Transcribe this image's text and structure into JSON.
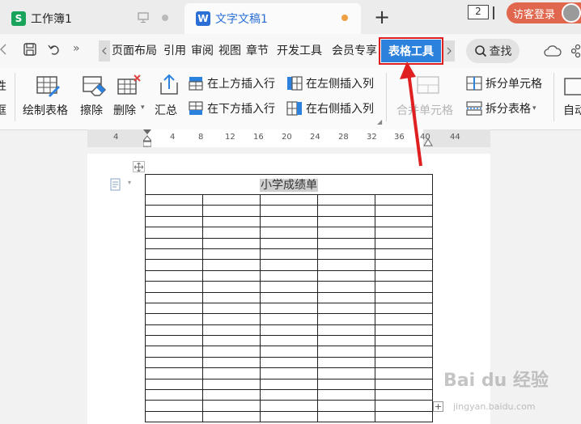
{
  "tabs": [
    {
      "label": "工作簿1",
      "icon": "S",
      "color": "#1aa35a"
    },
    {
      "label": "文字文稿1",
      "icon": "W",
      "color": "#2b6fd6"
    }
  ],
  "new_tab_symbol": "+",
  "window_count": "2",
  "login_label": "访客登录",
  "menu": {
    "items": [
      "页面布局",
      "引用",
      "审阅",
      "视图",
      "章节",
      "开发工具",
      "会员专享"
    ],
    "active": "表格工具",
    "search": "查找"
  },
  "ribbon": {
    "left_partial": [
      "性",
      "框"
    ],
    "draw_table": "绘制表格",
    "erase": "擦除",
    "delete": "删除",
    "summary": "汇总",
    "insert_above": "在上方插入行",
    "insert_below": "在下方插入行",
    "insert_left": "在左侧插入列",
    "insert_right": "在右侧插入列",
    "merge_cells": "合并单元格",
    "split_cells": "拆分单元格",
    "split_table": "拆分表格",
    "auto_partial": "自动"
  },
  "ruler_ticks": [
    "4",
    "4",
    "8",
    "12",
    "16",
    "20",
    "24",
    "28",
    "32",
    "36",
    "40",
    "44"
  ],
  "document": {
    "table_title": "小学成绩单",
    "columns": 5,
    "body_rows": 21
  },
  "watermark": {
    "brand": "Bai du 经验",
    "url": "jingyan.baidu.com"
  },
  "colors": {
    "accent": "#2c81dc",
    "annotation": "#e02020",
    "login": "#e0674e"
  }
}
